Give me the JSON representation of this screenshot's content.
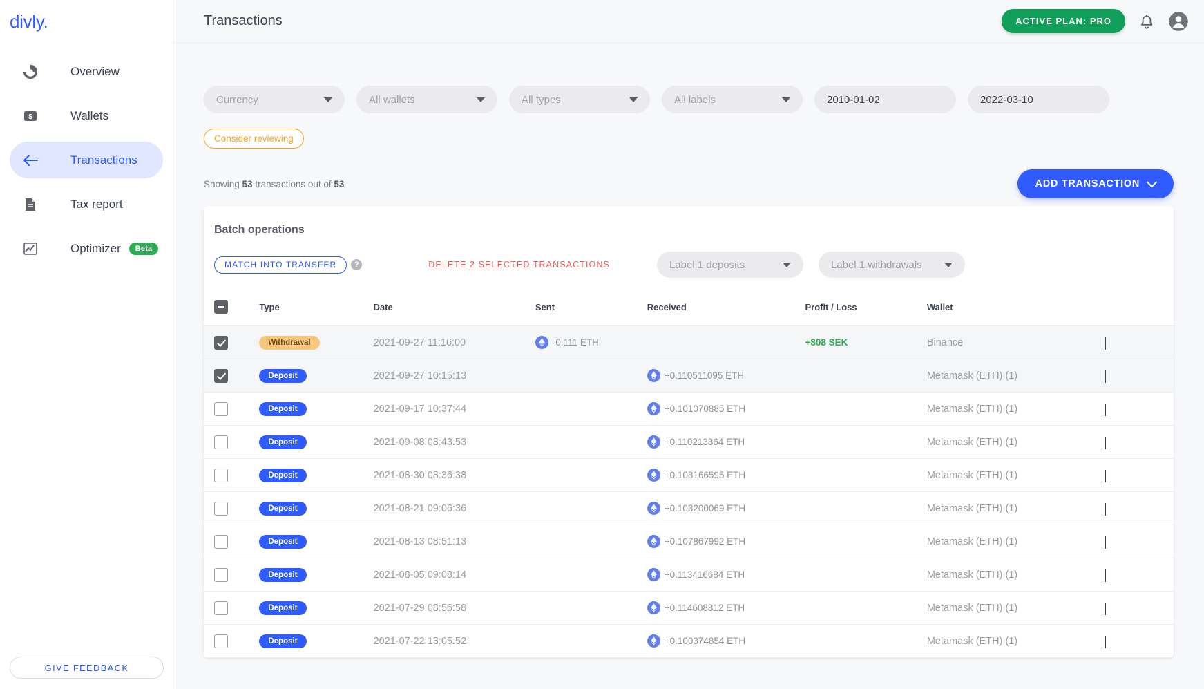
{
  "brand": {
    "logo": "divly."
  },
  "sidebar": {
    "items": [
      {
        "label": "Overview",
        "icon": "donut-chart-icon",
        "active": false,
        "badge": ""
      },
      {
        "label": "Wallets",
        "icon": "wallet-icon",
        "active": false,
        "badge": ""
      },
      {
        "label": "Transactions",
        "icon": "arrow-left-icon",
        "active": true,
        "badge": ""
      },
      {
        "label": "Tax report",
        "icon": "document-icon",
        "active": false,
        "badge": ""
      },
      {
        "label": "Optimizer",
        "icon": "line-chart-icon",
        "active": false,
        "badge": "Beta"
      }
    ],
    "feedback_label": "GIVE FEEDBACK"
  },
  "header": {
    "title": "Transactions",
    "plan_badge": "ACTIVE PLAN: PRO",
    "notification_icon": "bell-icon",
    "account_icon": "user-avatar-icon"
  },
  "filters": [
    {
      "name": "currency",
      "value": "Currency",
      "type": "select"
    },
    {
      "name": "wallets",
      "value": "All wallets",
      "type": "select"
    },
    {
      "name": "types",
      "value": "All types",
      "type": "select"
    },
    {
      "name": "labels",
      "value": "All labels",
      "type": "select"
    },
    {
      "name": "date-from",
      "value": "2010-01-02",
      "type": "date"
    },
    {
      "name": "date-to",
      "value": "2022-03-10",
      "type": "date"
    }
  ],
  "review_tag": "Consider reviewing",
  "showing": {
    "prefix": "Showing ",
    "count": "53",
    "middle": " transactions out of ",
    "total": "53"
  },
  "add_transaction_label": "ADD TRANSACTION",
  "batch": {
    "title": "Batch operations",
    "match_label": "MATCH INTO TRANSFER",
    "help_icon": "question-mark-icon",
    "delete_label": "DELETE 2 SELECTED TRANSACTIONS",
    "label_deposits": "Label 1 deposits",
    "label_withdrawals": "Label 1 withdrawals"
  },
  "table": {
    "columns": [
      "",
      "Type",
      "Date",
      "Sent",
      "Received",
      "Profit / Loss",
      "Wallet",
      ""
    ],
    "header_checkbox_state": "indeterminate",
    "rows": [
      {
        "checked": true,
        "type": "Withdrawal",
        "type_style": "withdrawal",
        "date": "2021-09-27 11:16:00",
        "sent": "-0.111 ETH",
        "received": "",
        "profit_loss": "+808 SEK",
        "wallet": "Binance"
      },
      {
        "checked": true,
        "type": "Deposit",
        "type_style": "deposit",
        "date": "2021-09-27 10:15:13",
        "sent": "",
        "received": "+0.110511095 ETH",
        "profit_loss": "",
        "wallet": "Metamask (ETH) (1)"
      },
      {
        "checked": false,
        "type": "Deposit",
        "type_style": "deposit",
        "date": "2021-09-17 10:37:44",
        "sent": "",
        "received": "+0.101070885 ETH",
        "profit_loss": "",
        "wallet": "Metamask (ETH) (1)"
      },
      {
        "checked": false,
        "type": "Deposit",
        "type_style": "deposit",
        "date": "2021-09-08 08:43:53",
        "sent": "",
        "received": "+0.110213864 ETH",
        "profit_loss": "",
        "wallet": "Metamask (ETH) (1)"
      },
      {
        "checked": false,
        "type": "Deposit",
        "type_style": "deposit",
        "date": "2021-08-30 08:36:38",
        "sent": "",
        "received": "+0.108166595 ETH",
        "profit_loss": "",
        "wallet": "Metamask (ETH) (1)"
      },
      {
        "checked": false,
        "type": "Deposit",
        "type_style": "deposit",
        "date": "2021-08-21 09:06:36",
        "sent": "",
        "received": "+0.103200069 ETH",
        "profit_loss": "",
        "wallet": "Metamask (ETH) (1)"
      },
      {
        "checked": false,
        "type": "Deposit",
        "type_style": "deposit",
        "date": "2021-08-13 08:51:13",
        "sent": "",
        "received": "+0.107867992 ETH",
        "profit_loss": "",
        "wallet": "Metamask (ETH) (1)"
      },
      {
        "checked": false,
        "type": "Deposit",
        "type_style": "deposit",
        "date": "2021-08-05 09:08:14",
        "sent": "",
        "received": "+0.113416684 ETH",
        "profit_loss": "",
        "wallet": "Metamask (ETH) (1)"
      },
      {
        "checked": false,
        "type": "Deposit",
        "type_style": "deposit",
        "date": "2021-07-29 08:56:58",
        "sent": "",
        "received": "+0.114608812 ETH",
        "profit_loss": "",
        "wallet": "Metamask (ETH) (1)"
      },
      {
        "checked": false,
        "type": "Deposit",
        "type_style": "deposit",
        "date": "2021-07-22 13:05:52",
        "sent": "",
        "received": "+0.100374854 ETH",
        "profit_loss": "",
        "wallet": "Metamask (ETH) (1)"
      }
    ]
  },
  "colors": {
    "accent_blue": "#2f5bff",
    "plan_green": "#11a05a",
    "profit_green": "#2eab54",
    "warning_orange": "#f5a623",
    "danger_red": "#ef5d5d",
    "deposit_blue": "#2f5bff",
    "withdrawal_amber": "#f8c77e"
  }
}
